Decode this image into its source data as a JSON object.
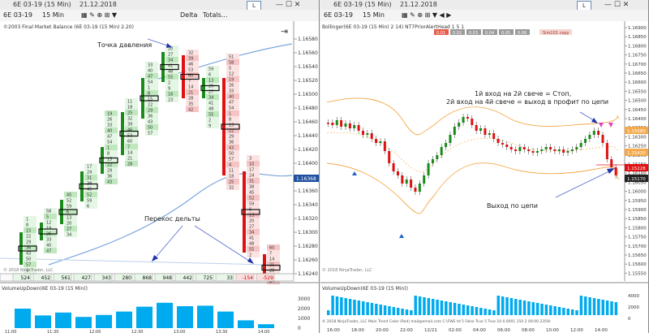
{
  "left": {
    "titlebar": {
      "instrument": "6E 03-19 (15 Min)",
      "date": "21.12.2018",
      "l": "L"
    },
    "toolbar": {
      "instrument": "6E 03-19",
      "interval": "15 Min",
      "indicator": "Delta",
      "totals": "Totals..."
    },
    "caption": "©2003 Final Market Balance (6E 03-19 (15 Min) 2.20)",
    "ann_pressure": "Точка давления",
    "ann_skew": "Перекос дельты",
    "copyright": "© 2018 NinjaTrader, LLC",
    "price_ticks": [
      "1.16580",
      "1.16560",
      "1.16540",
      "1.16520",
      "1.16500",
      "1.16480",
      "1.16460",
      "1.16440",
      "1.16420",
      "1.16400",
      "1.16380",
      "1.16360",
      "1.16340",
      "1.16320",
      "1.16300",
      "1.16280",
      "1.16260",
      "1.16240"
    ],
    "price_marker": "1.16368",
    "deltas": [
      "524",
      "452",
      "561",
      "427",
      "343",
      "280",
      "868",
      "948",
      "442",
      "725",
      "33",
      "-154",
      "-529"
    ],
    "vol_title": "VolumeUpDown(6E 03-19 (15 Min))",
    "vol_ticks": [
      "3000",
      "2000",
      "1000",
      "0"
    ],
    "vol_values": [
      2000,
      1300,
      1600,
      1150,
      1350,
      1700,
      2200,
      2600,
      2250,
      2300,
      1700,
      800,
      400
    ],
    "time_ticks": [
      "11:00",
      "11:30",
      "12:00",
      "12:30",
      "13:00",
      "13:30",
      "14:00"
    ]
  },
  "right": {
    "titlebar": {
      "instrument": "6E 03-19 (15 Min)",
      "date": "21.12.2018",
      "l": "L"
    },
    "toolbar": {
      "instrument": "6E 03-19",
      "interval": "15 Min"
    },
    "caption": "Bollinger(6E 03-19 (15 Min) 2 14)  NT7PriorAlertHead 1 5 1",
    "order_buttons": [
      "0.01",
      "0.02",
      "0.03",
      "0.04",
      "0.05",
      "0.06"
    ],
    "order_label": "Sim101 copy",
    "ann_entry1": "1й вход на 2й свече = Стоп,",
    "ann_entry2": "2й вход на 4й свече = выход в профит по цепи",
    "ann_exit": "Выход по цепи",
    "copyright": "© 2018 NinjaTrader, LLC",
    "price_ticks": [
      "1.16900",
      "1.16850",
      "1.16800",
      "1.16750",
      "1.16700",
      "1.16650",
      "1.16600",
      "1.16550",
      "1.16500",
      "1.16450",
      "1.16400",
      "1.16350",
      "1.16300",
      "1.16250",
      "1.16200",
      "1.16150",
      "1.16100",
      "1.16050",
      "1.16000",
      "1.15950",
      "1.15900",
      "1.15850",
      "1.15800",
      "1.15750",
      "1.15700",
      "1.15650",
      "1.15600",
      "1.15550"
    ],
    "price_markers": {
      "upper": "1.15680",
      "mid": "1.15420",
      "close": "1.15228",
      "last": "1.15170"
    },
    "vol_title": "VolumeUpDown(6E 03-19 (15 Min))",
    "vol_ticks": [
      "4000",
      "2000",
      "0"
    ],
    "status": "© 2018 NinjaTrader, LLC Main Trend Color (Red) mail@email.com C:\\FWE td 5 False True 5 True 10 0.0001 150 2 00:00 2359)",
    "time_ticks": [
      "16:00",
      "18:00",
      "20:00",
      "22:00",
      "12/21",
      "02:00",
      "04:00",
      "06:00",
      "08:00",
      "10:00",
      "12:00",
      "14:00"
    ]
  },
  "colors": {
    "up": "#1a8a1a",
    "down": "#e01010",
    "vol": "#00aaee",
    "band": "#f5a94a",
    "ma": "#7aa6dd"
  }
}
